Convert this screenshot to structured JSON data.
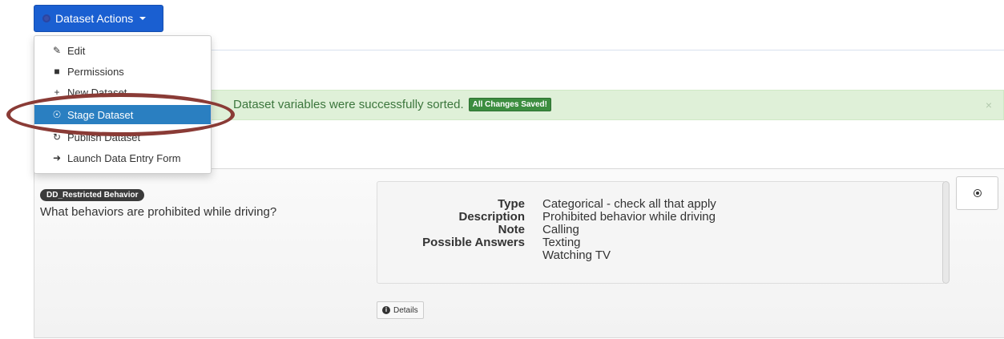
{
  "actions_button": {
    "label": "Dataset Actions",
    "icon": "gear-icon"
  },
  "menu": {
    "items": [
      {
        "label": "Edit",
        "icon": "edit-icon"
      },
      {
        "label": "Permissions",
        "icon": "lock-icon"
      },
      {
        "label": "New Dataset",
        "icon": "plus-icon"
      },
      {
        "label": "Stage Dataset",
        "icon": "stage-icon"
      },
      {
        "label": "Publish Dataset",
        "icon": "refresh-icon"
      },
      {
        "label": "Launch Data Entry Form",
        "icon": "arrow-icon"
      }
    ]
  },
  "alert": {
    "text": "Dataset variables were successfully sorted.",
    "badge": "All Changes Saved!",
    "close": "×"
  },
  "variable": {
    "name": "DD_Restricted Behavior",
    "question": "What behaviors are prohibited while driving?",
    "meta": {
      "type_label": "Type",
      "type_value": "Categorical - check all that apply",
      "description_label": "Description",
      "description_value": "Prohibited behavior while driving",
      "note_label": "Note",
      "note_value": "Calling",
      "answers_label": "Possible Answers",
      "answers": [
        "Texting",
        "Watching TV"
      ]
    },
    "details_label": "Details"
  }
}
